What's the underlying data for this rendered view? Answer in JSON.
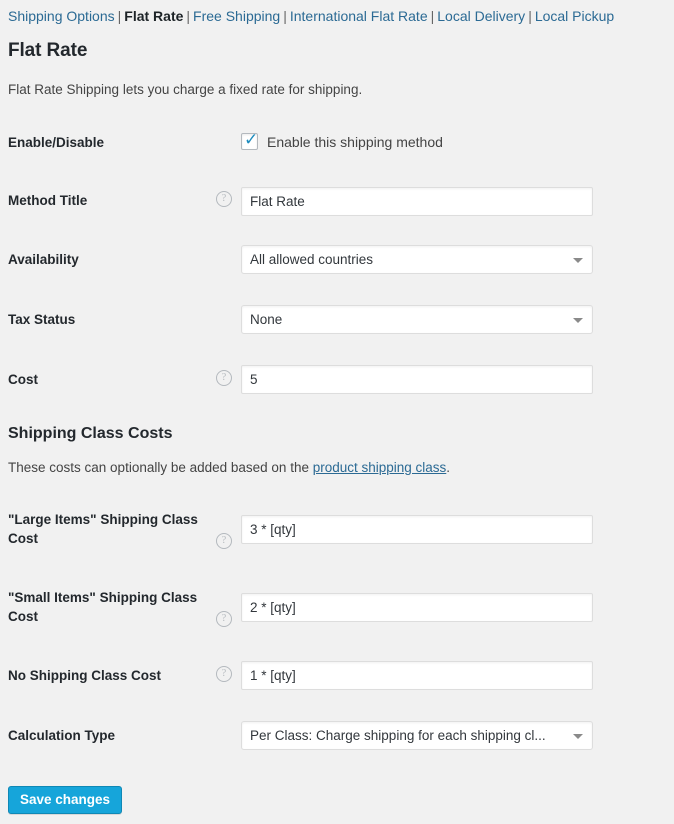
{
  "subnav": {
    "separator": "|",
    "items": [
      {
        "label": "Shipping Options",
        "current": false
      },
      {
        "label": "Flat Rate",
        "current": true
      },
      {
        "label": "Free Shipping",
        "current": false
      },
      {
        "label": "International Flat Rate",
        "current": false
      },
      {
        "label": "Local Delivery",
        "current": false
      },
      {
        "label": "Local Pickup",
        "current": false
      }
    ]
  },
  "header": {
    "title": "Flat Rate",
    "description": "Flat Rate Shipping lets you charge a fixed rate for shipping."
  },
  "shipping_class_section": {
    "title": "Shipping Class Costs",
    "description_before": "These costs can optionally be added based on the ",
    "link_text": "product shipping class",
    "description_after": "."
  },
  "help_icon": "?",
  "fields": {
    "enable_disable": {
      "label": "Enable/Disable",
      "checkbox_label": "Enable this shipping method",
      "checked": true,
      "tick": "✓"
    },
    "method_title": {
      "label": "Method Title",
      "value": "Flat Rate",
      "placeholder": ""
    },
    "availability": {
      "label": "Availability",
      "value": "All allowed countries"
    },
    "tax_status": {
      "label": "Tax Status",
      "value": "None"
    },
    "cost": {
      "label": "Cost",
      "value": "5",
      "placeholder": ""
    },
    "large_items_cost": {
      "label": "\"Large Items\" Shipping Class Cost",
      "value": "3 * [qty]",
      "placeholder": ""
    },
    "small_items_cost": {
      "label": "\"Small Items\" Shipping Class Cost",
      "value": "2 * [qty]",
      "placeholder": ""
    },
    "no_shipping_class_cost": {
      "label": "No Shipping Class Cost",
      "value": "1 * [qty]",
      "placeholder": ""
    },
    "calculation_type": {
      "label": "Calculation Type",
      "value": "Per Class: Charge shipping for each shipping cl..."
    }
  },
  "actions": {
    "save_label": "Save changes"
  },
  "colors": {
    "page_background": "#f1f1f1",
    "link": "#2b6a94",
    "accent_button": "#16a5da",
    "checkbox_tick": "#1e8cbe",
    "heading": "#23282d"
  }
}
